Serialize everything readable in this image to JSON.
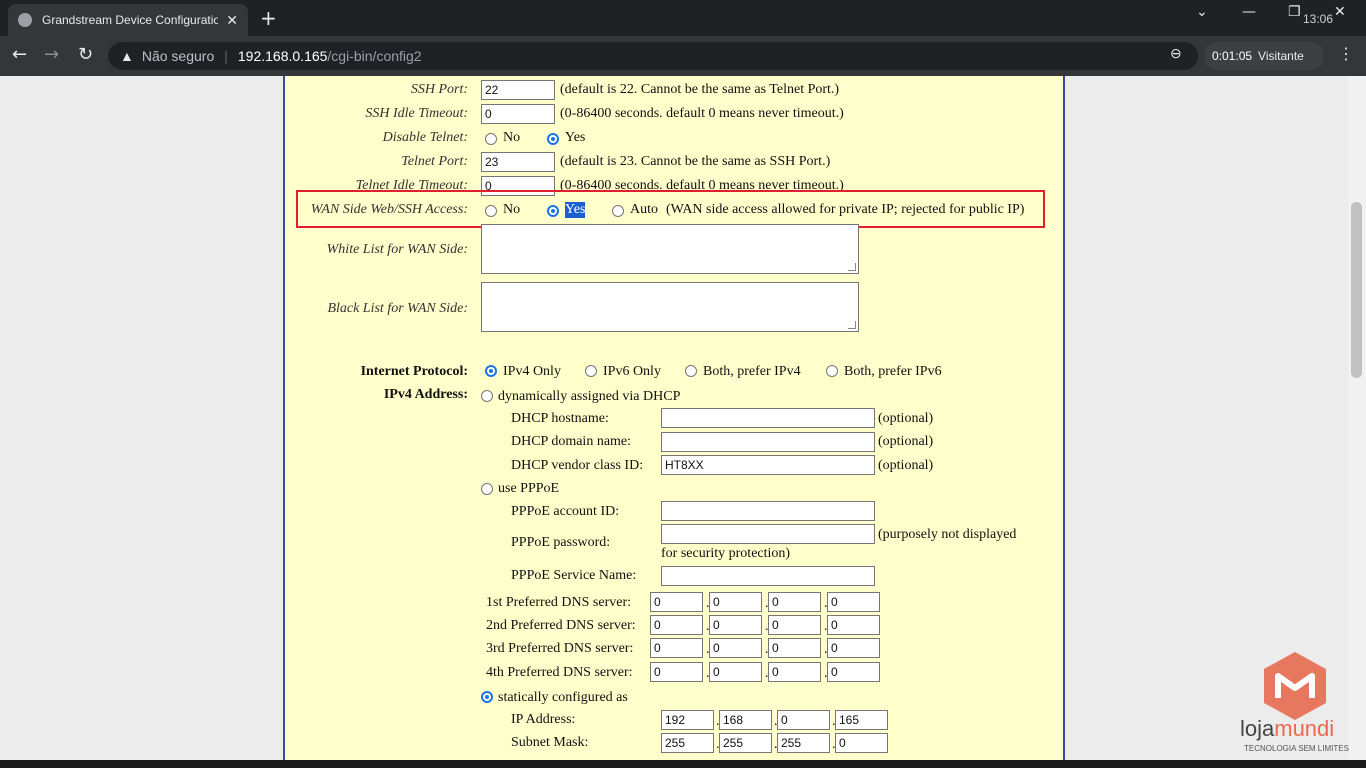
{
  "browser": {
    "tab_title": "Grandstream Device Configuratio",
    "tab_close": "✕",
    "new_tab": "+",
    "clock": "13:06",
    "security_label": "Não seguro",
    "url_host": "192.168.0.165",
    "url_path": "/cgi-bin/config2",
    "profile_label": "Visitante",
    "video_time": "0:01:05",
    "minimize": "⌄",
    "restore": "—",
    "close": "✕"
  },
  "form": {
    "ssh_port": {
      "label": "SSH Port:",
      "value": "22",
      "note": "(default is 22. Cannot be the same as Telnet Port.)"
    },
    "ssh_idle_timeout": {
      "label": "SSH Idle Timeout:",
      "value": "0",
      "note": "(0-86400 seconds. default 0 means never timeout.)"
    },
    "disable_telnet": {
      "label": "Disable Telnet:",
      "options": [
        "No",
        "Yes"
      ],
      "selected": "Yes"
    },
    "telnet_port": {
      "label": "Telnet Port:",
      "value": "23",
      "note": "(default is 23. Cannot be the same as SSH Port.)"
    },
    "telnet_idle_timeout": {
      "label": "Telnet Idle Timeout:",
      "value": "0",
      "note": "(0-86400 seconds. default 0 means never timeout.)"
    },
    "wan_side_access": {
      "label": "WAN Side Web/SSH Access:",
      "options": [
        "No",
        "Yes",
        "Auto"
      ],
      "selected": "Yes",
      "note": "(WAN side access allowed for private IP; rejected for public IP)"
    },
    "white_list": {
      "label": "White List for WAN Side:"
    },
    "black_list": {
      "label": "Black List for WAN Side:"
    },
    "internet_protocol": {
      "label": "Internet Protocol:",
      "options": [
        "IPv4 Only",
        "IPv6 Only",
        "Both, prefer IPv4",
        "Both, prefer IPv6"
      ],
      "selected": "IPv4 Only"
    },
    "ipv4_address": {
      "label": "IPv4 Address:",
      "dhcp_option": "dynamically assigned via DHCP",
      "dhcp_hostname": {
        "label": "DHCP hostname:",
        "value": "",
        "note": "(optional)"
      },
      "dhcp_domain": {
        "label": "DHCP domain name:",
        "value": "",
        "note": "(optional)"
      },
      "dhcp_vendor": {
        "label": "DHCP vendor class ID:",
        "value": "HT8XX",
        "note": "(optional)"
      },
      "pppoe_option": "use PPPoE",
      "pppoe_account": {
        "label": "PPPoE account ID:",
        "value": ""
      },
      "pppoe_password": {
        "label": "PPPoE password:",
        "value": "",
        "note1": "(purposely not displayed",
        "note2": "for security protection)"
      },
      "pppoe_service": {
        "label": "PPPoE Service Name:",
        "value": ""
      },
      "dns": [
        {
          "label": "1st Preferred DNS server:",
          "octets": [
            "0",
            "0",
            "0",
            "0"
          ]
        },
        {
          "label": "2nd Preferred DNS server:",
          "octets": [
            "0",
            "0",
            "0",
            "0"
          ]
        },
        {
          "label": "3rd Preferred DNS server:",
          "octets": [
            "0",
            "0",
            "0",
            "0"
          ]
        },
        {
          "label": "4th Preferred DNS server:",
          "octets": [
            "0",
            "0",
            "0",
            "0"
          ]
        }
      ],
      "static_option": "statically configured as",
      "ip_address": {
        "label": "IP Address:",
        "octets": [
          "192",
          "168",
          "0",
          "165"
        ]
      },
      "subnet_mask": {
        "label": "Subnet Mask:",
        "octets": [
          "255",
          "255",
          "255",
          "0"
        ]
      },
      "selected": "static"
    }
  },
  "watermark": {
    "brand_a": "loja",
    "brand_b": "mundi",
    "tagline": "TECNOLOGIA SEM LIMITES",
    "accent": "#e86a50"
  }
}
